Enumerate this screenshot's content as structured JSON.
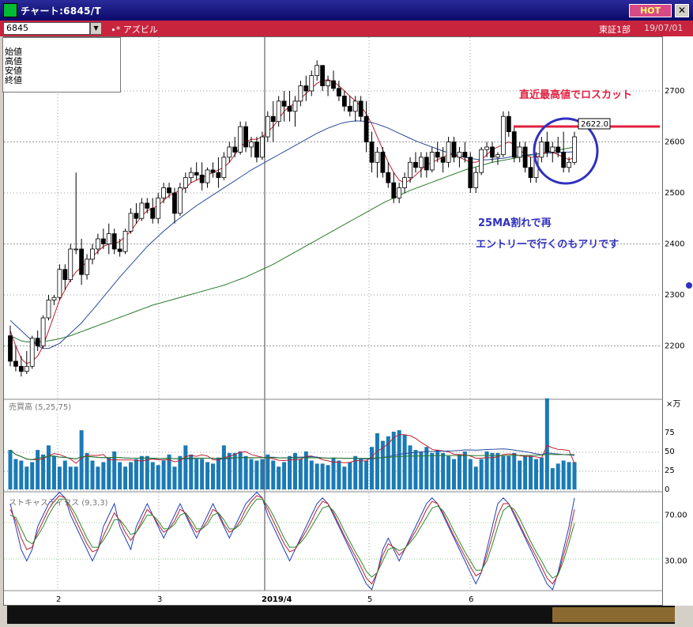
{
  "window": {
    "title": "チャート:6845/T",
    "hot": "HOT",
    "close": "✕"
  },
  "toolbar": {
    "symbol": "6845",
    "name": "∙* アズビル",
    "market": "東証1部",
    "date": "19/07/01"
  },
  "ohlc": {
    "labels": [
      "始値",
      "高値",
      "安値",
      "終値"
    ]
  },
  "price_axis": [
    "2700",
    "2600",
    "2500",
    "2400",
    "2300",
    "2200"
  ],
  "volume_axis": {
    "unit": "×万",
    "ticks": [
      "75",
      "50",
      "25",
      "0"
    ]
  },
  "stoch_axis": [
    "70.00",
    "30.00"
  ],
  "x_axis": [
    "2",
    "3",
    "2019/4",
    "5",
    "6"
  ],
  "panels": {
    "volume_label": "売買高 (5,25,75)",
    "stoch_label": "ストキャスティクス (9,3,3)"
  },
  "annotations": {
    "stop_loss": "直近最高値でロスカット",
    "reentry_line1": "25MA割れで再",
    "reentry_line2": "エントリーで行くのもアリです",
    "price_tag": "2622.0"
  },
  "colors": {
    "stop_line": "#e02040",
    "circle": "#3030c0",
    "note_red": "#e02040",
    "note_blue": "#3030c0"
  },
  "chart_data": {
    "type": "candlestick",
    "ylim": [
      2130,
      2760
    ],
    "candles": [
      [
        2220,
        2240,
        2160,
        2170
      ],
      [
        2170,
        2200,
        2150,
        2160
      ],
      [
        2160,
        2180,
        2140,
        2150
      ],
      [
        2150,
        2190,
        2145,
        2160
      ],
      [
        2160,
        2220,
        2155,
        2215
      ],
      [
        2215,
        2230,
        2190,
        2200
      ],
      [
        2200,
        2260,
        2195,
        2255
      ],
      [
        2255,
        2300,
        2250,
        2290
      ],
      [
        2290,
        2300,
        2280,
        2295
      ],
      [
        2295,
        2360,
        2290,
        2350
      ],
      [
        2350,
        2360,
        2310,
        2330
      ],
      [
        2330,
        2400,
        2325,
        2390
      ],
      [
        2390,
        2540,
        2380,
        2390
      ],
      [
        2390,
        2410,
        2320,
        2340
      ],
      [
        2340,
        2380,
        2330,
        2370
      ],
      [
        2370,
        2400,
        2360,
        2390
      ],
      [
        2390,
        2420,
        2380,
        2410
      ],
      [
        2410,
        2430,
        2390,
        2400
      ],
      [
        2400,
        2440,
        2380,
        2420
      ],
      [
        2420,
        2430,
        2380,
        2390
      ],
      [
        2390,
        2410,
        2375,
        2385
      ],
      [
        2385,
        2430,
        2380,
        2425
      ],
      [
        2425,
        2470,
        2420,
        2460
      ],
      [
        2460,
        2480,
        2440,
        2450
      ],
      [
        2450,
        2490,
        2445,
        2480
      ],
      [
        2480,
        2490,
        2460,
        2470
      ],
      [
        2470,
        2490,
        2440,
        2450
      ],
      [
        2450,
        2500,
        2440,
        2490
      ],
      [
        2490,
        2520,
        2480,
        2510
      ],
      [
        2510,
        2520,
        2490,
        2500
      ],
      [
        2500,
        2510,
        2440,
        2460
      ],
      [
        2460,
        2520,
        2455,
        2510
      ],
      [
        2510,
        2540,
        2500,
        2530
      ],
      [
        2530,
        2550,
        2520,
        2540
      ],
      [
        2540,
        2560,
        2525,
        2535
      ],
      [
        2535,
        2560,
        2505,
        2520
      ],
      [
        2520,
        2550,
        2510,
        2545
      ],
      [
        2545,
        2560,
        2530,
        2540
      ],
      [
        2540,
        2570,
        2510,
        2530
      ],
      [
        2530,
        2580,
        2525,
        2570
      ],
      [
        2570,
        2600,
        2560,
        2590
      ],
      [
        2590,
        2610,
        2570,
        2580
      ],
      [
        2580,
        2640,
        2575,
        2630
      ],
      [
        2630,
        2640,
        2580,
        2590
      ],
      [
        2590,
        2610,
        2570,
        2600
      ],
      [
        2600,
        2610,
        2560,
        2570
      ],
      [
        2570,
        2620,
        2565,
        2610
      ],
      [
        2610,
        2660,
        2600,
        2650
      ],
      [
        2650,
        2680,
        2600,
        2640
      ],
      [
        2640,
        2690,
        2630,
        2680
      ],
      [
        2680,
        2700,
        2640,
        2670
      ],
      [
        2670,
        2700,
        2640,
        2660
      ],
      [
        2660,
        2690,
        2630,
        2680
      ],
      [
        2680,
        2720,
        2670,
        2710
      ],
      [
        2710,
        2730,
        2680,
        2700
      ],
      [
        2700,
        2740,
        2690,
        2730
      ],
      [
        2730,
        2760,
        2720,
        2750
      ],
      [
        2750,
        2750,
        2700,
        2710
      ],
      [
        2710,
        2730,
        2690,
        2720
      ],
      [
        2720,
        2740,
        2700,
        2705
      ],
      [
        2705,
        2720,
        2680,
        2690
      ],
      [
        2690,
        2700,
        2660,
        2670
      ],
      [
        2670,
        2690,
        2650,
        2660
      ],
      [
        2660,
        2690,
        2640,
        2680
      ],
      [
        2680,
        2690,
        2640,
        2650
      ],
      [
        2650,
        2680,
        2580,
        2600
      ],
      [
        2600,
        2620,
        2540,
        2560
      ],
      [
        2560,
        2590,
        2530,
        2580
      ],
      [
        2580,
        2590,
        2530,
        2540
      ],
      [
        2540,
        2560,
        2510,
        2520
      ],
      [
        2520,
        2540,
        2480,
        2490
      ],
      [
        2490,
        2520,
        2480,
        2510
      ],
      [
        2510,
        2540,
        2500,
        2530
      ],
      [
        2530,
        2570,
        2520,
        2560
      ],
      [
        2560,
        2580,
        2540,
        2550
      ],
      [
        2550,
        2580,
        2530,
        2570
      ],
      [
        2570,
        2580,
        2530,
        2545
      ],
      [
        2545,
        2590,
        2540,
        2580
      ],
      [
        2580,
        2600,
        2560,
        2570
      ],
      [
        2570,
        2590,
        2540,
        2560
      ],
      [
        2560,
        2610,
        2550,
        2600
      ],
      [
        2600,
        2610,
        2560,
        2570
      ],
      [
        2570,
        2590,
        2550,
        2580
      ],
      [
        2580,
        2600,
        2560,
        2570
      ],
      [
        2570,
        2580,
        2500,
        2510
      ],
      [
        2510,
        2550,
        2500,
        2540
      ],
      [
        2540,
        2590,
        2535,
        2585
      ],
      [
        2585,
        2600,
        2570,
        2590
      ],
      [
        2590,
        2600,
        2560,
        2570
      ],
      [
        2570,
        2580,
        2555,
        2575
      ],
      [
        2575,
        2660,
        2570,
        2650
      ],
      [
        2650,
        2660,
        2610,
        2620
      ],
      [
        2620,
        2630,
        2560,
        2570
      ],
      [
        2570,
        2600,
        2560,
        2590
      ],
      [
        2590,
        2600,
        2540,
        2550
      ],
      [
        2550,
        2570,
        2520,
        2530
      ],
      [
        2530,
        2580,
        2520,
        2570
      ],
      [
        2570,
        2610,
        2560,
        2600
      ],
      [
        2600,
        2620,
        2570,
        2580
      ],
      [
        2580,
        2600,
        2560,
        2590
      ],
      [
        2590,
        2610,
        2570,
        2580
      ],
      [
        2580,
        2620,
        2540,
        2550
      ],
      [
        2550,
        2570,
        2540,
        2560
      ],
      [
        2560,
        2620,
        2555,
        2610
      ]
    ],
    "ma5": [
      2230,
      2200,
      2175,
      2165,
      2170,
      2180,
      2200,
      2230,
      2260,
      2290,
      2310,
      2330,
      2345,
      2355,
      2365,
      2375,
      2385,
      2395,
      2400,
      2400,
      2405,
      2415,
      2425,
      2440,
      2455,
      2465,
      2470,
      2475,
      2485,
      2495,
      2500,
      2505,
      2510,
      2520,
      2525,
      2530,
      2535,
      2540,
      2545,
      2550,
      2560,
      2575,
      2590,
      2600,
      2605,
      2605,
      2610,
      2620,
      2630,
      2645,
      2660,
      2670,
      2675,
      2685,
      2695,
      2705,
      2715,
      2720,
      2722,
      2718,
      2710,
      2700,
      2690,
      2680,
      2670,
      2655,
      2635,
      2610,
      2585,
      2560,
      2540,
      2525,
      2520,
      2525,
      2535,
      2545,
      2555,
      2560,
      2565,
      2570,
      2575,
      2575,
      2570,
      2565,
      2560,
      2560,
      2565,
      2575,
      2585,
      2590,
      2595,
      2600,
      2595,
      2585,
      2575,
      2570,
      2570,
      2575,
      2580,
      2580,
      2575,
      2570,
      2565,
      2570
    ],
    "ma25": [
      2250,
      2240,
      2230,
      2220,
      2210,
      2200,
      2195,
      2195,
      2200,
      2205,
      2215,
      2225,
      2235,
      2245,
      2258,
      2270,
      2283,
      2296,
      2309,
      2322,
      2335,
      2347,
      2359,
      2371,
      2383,
      2395,
      2405,
      2415,
      2425,
      2434,
      2443,
      2451,
      2459,
      2467,
      2475,
      2482,
      2489,
      2496,
      2503,
      2510,
      2517,
      2524,
      2531,
      2538,
      2545,
      2551,
      2557,
      2563,
      2569,
      2575,
      2581,
      2587,
      2593,
      2599,
      2605,
      2611,
      2617,
      2622,
      2627,
      2631,
      2635,
      2638,
      2640,
      2641,
      2641,
      2640,
      2638,
      2635,
      2631,
      2627,
      2622,
      2617,
      2612,
      2607,
      2602,
      2598,
      2594,
      2590,
      2586,
      2582,
      2579,
      2576,
      2573,
      2570,
      2568,
      2566,
      2565,
      2565,
      2566,
      2567,
      2568,
      2570,
      2572,
      2573,
      2574,
      2575,
      2576,
      2577,
      2578,
      2578,
      2579,
      2580,
      2580,
      2581
    ],
    "ma75": [
      2220,
      2215,
      2210,
      2208,
      2208,
      2208,
      2209,
      2210,
      2212,
      2214,
      2217,
      2220,
      2224,
      2228,
      2232,
      2236,
      2240,
      2244,
      2248,
      2252,
      2256,
      2260,
      2264,
      2268,
      2272,
      2276,
      2280,
      2283,
      2286,
      2289,
      2292,
      2295,
      2298,
      2301,
      2304,
      2307,
      2310,
      2313,
      2316,
      2319,
      2323,
      2327,
      2331,
      2335,
      2340,
      2345,
      2350,
      2355,
      2360,
      2366,
      2372,
      2378,
      2384,
      2390,
      2396,
      2402,
      2408,
      2414,
      2420,
      2426,
      2432,
      2438,
      2444,
      2450,
      2456,
      2462,
      2468,
      2474,
      2480,
      2485,
      2490,
      2495,
      2500,
      2505,
      2509,
      2513,
      2517,
      2521,
      2525,
      2529,
      2533,
      2537,
      2541,
      2545,
      2548,
      2551,
      2554,
      2557,
      2560,
      2562,
      2564,
      2566,
      2568,
      2570,
      2572,
      2574,
      2576,
      2578,
      2580,
      2582,
      2584,
      2586,
      2588,
      2590
    ],
    "volume": [
      52,
      40,
      38,
      30,
      36,
      52,
      46,
      58,
      44,
      30,
      38,
      30,
      30,
      78,
      48,
      38,
      30,
      36,
      42,
      50,
      36,
      30,
      36,
      40,
      44,
      44,
      36,
      32,
      38,
      46,
      30,
      44,
      58,
      46,
      40,
      40,
      36,
      34,
      42,
      58,
      48,
      48,
      50,
      44,
      40,
      38,
      40,
      46,
      38,
      30,
      36,
      44,
      48,
      40,
      50,
      38,
      34,
      34,
      32,
      42,
      38,
      30,
      36,
      44,
      40,
      38,
      56,
      74,
      64,
      70,
      76,
      78,
      72,
      58,
      52,
      50,
      56,
      48,
      52,
      48,
      44,
      40,
      46,
      50,
      40,
      30,
      40,
      50,
      48,
      48,
      44,
      44,
      48,
      38,
      44,
      44,
      40,
      42,
      120,
      28,
      34,
      38,
      36,
      36
    ],
    "stoch_k": [
      80,
      60,
      40,
      30,
      40,
      60,
      70,
      80,
      85,
      90,
      85,
      70,
      60,
      50,
      40,
      30,
      40,
      60,
      70,
      80,
      60,
      50,
      40,
      60,
      70,
      80,
      70,
      60,
      50,
      60,
      70,
      80,
      70,
      60,
      50,
      60,
      70,
      80,
      70,
      60,
      50,
      60,
      70,
      80,
      85,
      90,
      85,
      70,
      60,
      50,
      40,
      30,
      40,
      50,
      60,
      70,
      80,
      85,
      80,
      70,
      60,
      50,
      40,
      30,
      20,
      10,
      5,
      20,
      40,
      50,
      40,
      30,
      40,
      50,
      60,
      70,
      80,
      85,
      80,
      70,
      60,
      50,
      40,
      30,
      20,
      10,
      20,
      40,
      60,
      80,
      85,
      80,
      70,
      60,
      50,
      40,
      30,
      20,
      10,
      5,
      20,
      40,
      60,
      85
    ],
    "stoch_d": [
      75,
      65,
      50,
      40,
      42,
      55,
      65,
      75,
      82,
      87,
      85,
      75,
      65,
      55,
      45,
      38,
      40,
      52,
      62,
      72,
      65,
      55,
      48,
      55,
      65,
      75,
      70,
      62,
      55,
      58,
      65,
      75,
      72,
      62,
      55,
      58,
      65,
      75,
      72,
      62,
      55,
      58,
      65,
      75,
      82,
      87,
      85,
      75,
      65,
      55,
      45,
      38,
      40,
      48,
      56,
      65,
      75,
      82,
      80,
      72,
      62,
      52,
      43,
      34,
      25,
      15,
      10,
      20,
      35,
      45,
      42,
      35,
      40,
      48,
      56,
      65,
      75,
      82,
      80,
      72,
      62,
      52,
      43,
      34,
      25,
      17,
      20,
      35,
      52,
      70,
      80,
      80,
      72,
      62,
      52,
      43,
      34,
      25,
      15,
      10,
      18,
      35,
      52,
      75
    ],
    "stoch_sd": [
      70,
      68,
      58,
      48,
      45,
      52,
      60,
      70,
      78,
      84,
      84,
      78,
      70,
      60,
      50,
      42,
      42,
      48,
      56,
      66,
      66,
      60,
      53,
      55,
      62,
      70,
      70,
      65,
      58,
      58,
      62,
      70,
      72,
      66,
      58,
      58,
      62,
      70,
      72,
      66,
      58,
      58,
      62,
      70,
      78,
      84,
      84,
      78,
      70,
      60,
      50,
      42,
      42,
      46,
      52,
      60,
      68,
      76,
      78,
      74,
      66,
      56,
      47,
      38,
      30,
      21,
      16,
      20,
      30,
      40,
      42,
      39,
      41,
      46,
      52,
      60,
      68,
      76,
      78,
      74,
      66,
      56,
      47,
      38,
      30,
      22,
      22,
      30,
      44,
      60,
      74,
      78,
      75,
      67,
      57,
      47,
      38,
      30,
      21,
      15,
      18,
      30,
      46,
      63
    ]
  }
}
